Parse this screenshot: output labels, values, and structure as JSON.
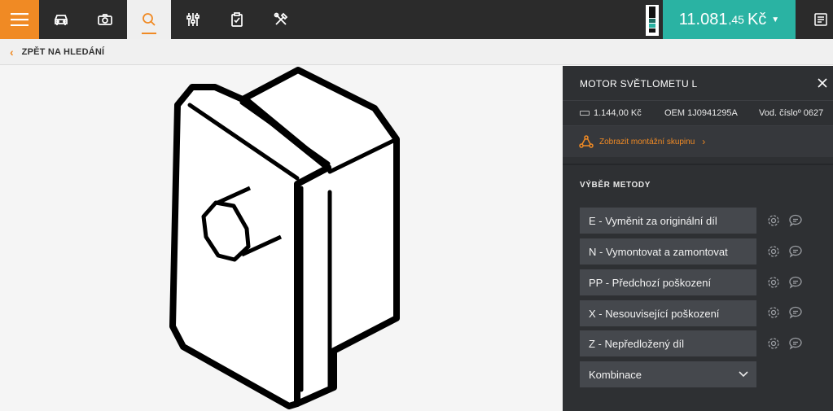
{
  "header": {
    "nav_icons": [
      "menu-icon",
      "car-icon",
      "camera-icon",
      "search-icon",
      "sliders-icon",
      "clipboard-check-icon",
      "tools-icon",
      "receipt-icon"
    ],
    "price": {
      "main": "11.081",
      "decimals": ",45",
      "currency": "Kč"
    }
  },
  "subbar": {
    "back_label": "ZPĚT NA HLEDÁNÍ"
  },
  "panel": {
    "title": "MOTOR SVĚTLOMETU L",
    "price": "1.144,00 Kč",
    "oem": "OEM 1J0941295A",
    "vod": "Vod. čísloº 0627",
    "assembly_link": "Zobrazit montážní skupinu",
    "section_title": "VÝBĚR METODY",
    "methods": [
      "E - Vyměnit za originální díl",
      "N - Vymontovat a zamontovat",
      "PP - Předchozí poškození",
      "X - Nesouvisející poškození",
      "Z - Nepředložený díl"
    ],
    "combo": "Kombinace"
  },
  "colors": {
    "accent": "#f08a24",
    "teal": "#2ab3a3",
    "panel": "#2e3033",
    "topbar": "#2b2b2b"
  }
}
